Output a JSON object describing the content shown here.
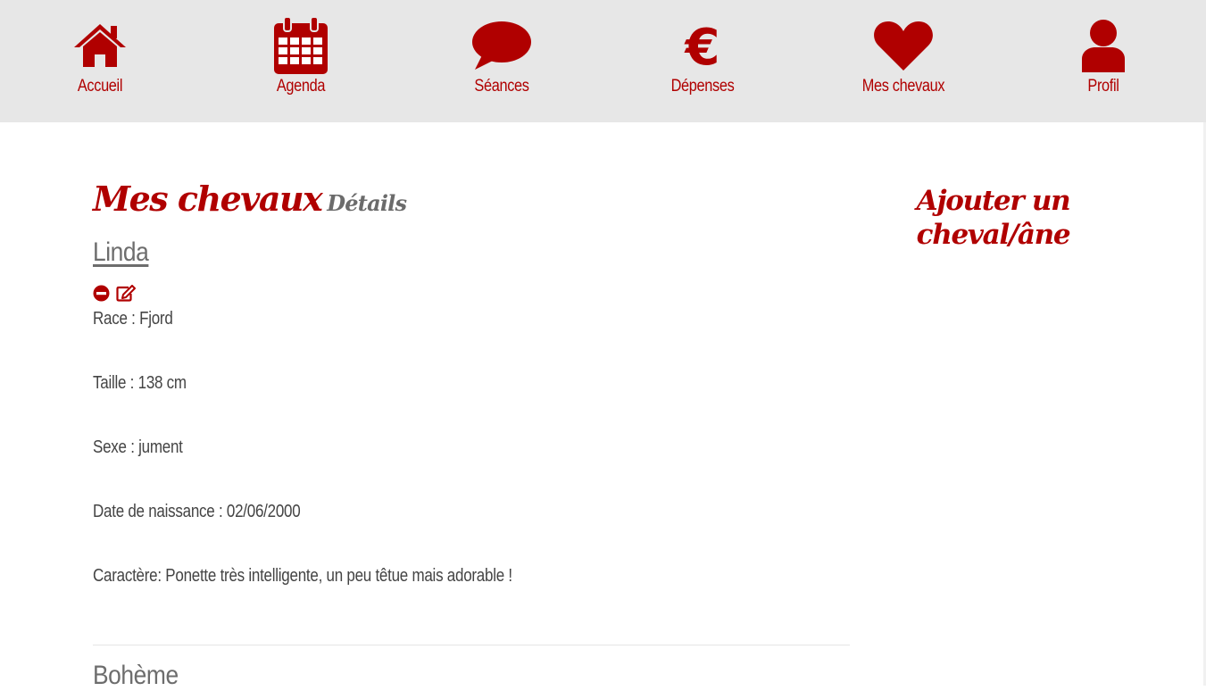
{
  "nav": {
    "items": [
      {
        "label": "Accueil",
        "icon": "home-icon"
      },
      {
        "label": "Agenda",
        "icon": "calendar-icon"
      },
      {
        "label": "Séances",
        "icon": "speech-bubble-icon"
      },
      {
        "label": "Dépenses",
        "icon": "euro-icon"
      },
      {
        "label": "Mes chevaux",
        "icon": "heart-icon"
      },
      {
        "label": "Profil",
        "icon": "user-icon"
      }
    ]
  },
  "page": {
    "title": "Mes chevaux",
    "subtitle": "Détails",
    "add_link": "Ajouter un cheval/âne"
  },
  "horses": [
    {
      "name": "Linda",
      "fields": [
        "Race : Fjord",
        "Taille : 138 cm",
        "Sexe : jument",
        "Date de naissance : 02/06/2000",
        "Caractère: Ponette très intelligente, un peu têtue mais adorable !"
      ]
    },
    {
      "name": "Bohème"
    }
  ],
  "colors": {
    "accent": "#b00000",
    "nav_bg": "#e7e7e7",
    "text": "#444444",
    "muted": "#6d6d6d"
  }
}
